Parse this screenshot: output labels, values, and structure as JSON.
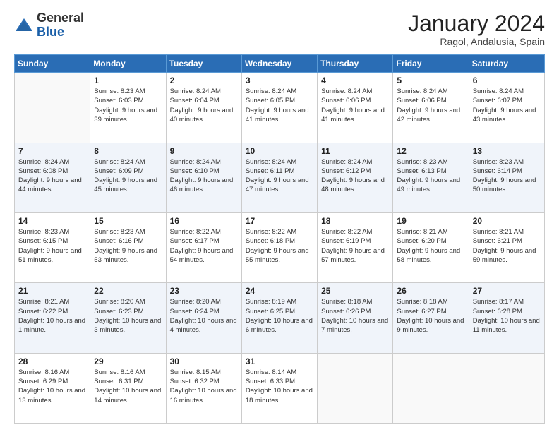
{
  "logo": {
    "general": "General",
    "blue": "Blue"
  },
  "header": {
    "month": "January 2024",
    "location": "Ragol, Andalusia, Spain"
  },
  "days_of_week": [
    "Sunday",
    "Monday",
    "Tuesday",
    "Wednesday",
    "Thursday",
    "Friday",
    "Saturday"
  ],
  "weeks": [
    [
      {
        "day": "",
        "info": ""
      },
      {
        "day": "1",
        "info": "Sunrise: 8:23 AM\nSunset: 6:03 PM\nDaylight: 9 hours\nand 39 minutes."
      },
      {
        "day": "2",
        "info": "Sunrise: 8:24 AM\nSunset: 6:04 PM\nDaylight: 9 hours\nand 40 minutes."
      },
      {
        "day": "3",
        "info": "Sunrise: 8:24 AM\nSunset: 6:05 PM\nDaylight: 9 hours\nand 41 minutes."
      },
      {
        "day": "4",
        "info": "Sunrise: 8:24 AM\nSunset: 6:06 PM\nDaylight: 9 hours\nand 41 minutes."
      },
      {
        "day": "5",
        "info": "Sunrise: 8:24 AM\nSunset: 6:06 PM\nDaylight: 9 hours\nand 42 minutes."
      },
      {
        "day": "6",
        "info": "Sunrise: 8:24 AM\nSunset: 6:07 PM\nDaylight: 9 hours\nand 43 minutes."
      }
    ],
    [
      {
        "day": "7",
        "info": "Sunrise: 8:24 AM\nSunset: 6:08 PM\nDaylight: 9 hours\nand 44 minutes."
      },
      {
        "day": "8",
        "info": "Sunrise: 8:24 AM\nSunset: 6:09 PM\nDaylight: 9 hours\nand 45 minutes."
      },
      {
        "day": "9",
        "info": "Sunrise: 8:24 AM\nSunset: 6:10 PM\nDaylight: 9 hours\nand 46 minutes."
      },
      {
        "day": "10",
        "info": "Sunrise: 8:24 AM\nSunset: 6:11 PM\nDaylight: 9 hours\nand 47 minutes."
      },
      {
        "day": "11",
        "info": "Sunrise: 8:24 AM\nSunset: 6:12 PM\nDaylight: 9 hours\nand 48 minutes."
      },
      {
        "day": "12",
        "info": "Sunrise: 8:23 AM\nSunset: 6:13 PM\nDaylight: 9 hours\nand 49 minutes."
      },
      {
        "day": "13",
        "info": "Sunrise: 8:23 AM\nSunset: 6:14 PM\nDaylight: 9 hours\nand 50 minutes."
      }
    ],
    [
      {
        "day": "14",
        "info": "Sunrise: 8:23 AM\nSunset: 6:15 PM\nDaylight: 9 hours\nand 51 minutes."
      },
      {
        "day": "15",
        "info": "Sunrise: 8:23 AM\nSunset: 6:16 PM\nDaylight: 9 hours\nand 53 minutes."
      },
      {
        "day": "16",
        "info": "Sunrise: 8:22 AM\nSunset: 6:17 PM\nDaylight: 9 hours\nand 54 minutes."
      },
      {
        "day": "17",
        "info": "Sunrise: 8:22 AM\nSunset: 6:18 PM\nDaylight: 9 hours\nand 55 minutes."
      },
      {
        "day": "18",
        "info": "Sunrise: 8:22 AM\nSunset: 6:19 PM\nDaylight: 9 hours\nand 57 minutes."
      },
      {
        "day": "19",
        "info": "Sunrise: 8:21 AM\nSunset: 6:20 PM\nDaylight: 9 hours\nand 58 minutes."
      },
      {
        "day": "20",
        "info": "Sunrise: 8:21 AM\nSunset: 6:21 PM\nDaylight: 9 hours\nand 59 minutes."
      }
    ],
    [
      {
        "day": "21",
        "info": "Sunrise: 8:21 AM\nSunset: 6:22 PM\nDaylight: 10 hours\nand 1 minute."
      },
      {
        "day": "22",
        "info": "Sunrise: 8:20 AM\nSunset: 6:23 PM\nDaylight: 10 hours\nand 3 minutes."
      },
      {
        "day": "23",
        "info": "Sunrise: 8:20 AM\nSunset: 6:24 PM\nDaylight: 10 hours\nand 4 minutes."
      },
      {
        "day": "24",
        "info": "Sunrise: 8:19 AM\nSunset: 6:25 PM\nDaylight: 10 hours\nand 6 minutes."
      },
      {
        "day": "25",
        "info": "Sunrise: 8:18 AM\nSunset: 6:26 PM\nDaylight: 10 hours\nand 7 minutes."
      },
      {
        "day": "26",
        "info": "Sunrise: 8:18 AM\nSunset: 6:27 PM\nDaylight: 10 hours\nand 9 minutes."
      },
      {
        "day": "27",
        "info": "Sunrise: 8:17 AM\nSunset: 6:28 PM\nDaylight: 10 hours\nand 11 minutes."
      }
    ],
    [
      {
        "day": "28",
        "info": "Sunrise: 8:16 AM\nSunset: 6:29 PM\nDaylight: 10 hours\nand 13 minutes."
      },
      {
        "day": "29",
        "info": "Sunrise: 8:16 AM\nSunset: 6:31 PM\nDaylight: 10 hours\nand 14 minutes."
      },
      {
        "day": "30",
        "info": "Sunrise: 8:15 AM\nSunset: 6:32 PM\nDaylight: 10 hours\nand 16 minutes."
      },
      {
        "day": "31",
        "info": "Sunrise: 8:14 AM\nSunset: 6:33 PM\nDaylight: 10 hours\nand 18 minutes."
      },
      {
        "day": "",
        "info": ""
      },
      {
        "day": "",
        "info": ""
      },
      {
        "day": "",
        "info": ""
      }
    ]
  ]
}
